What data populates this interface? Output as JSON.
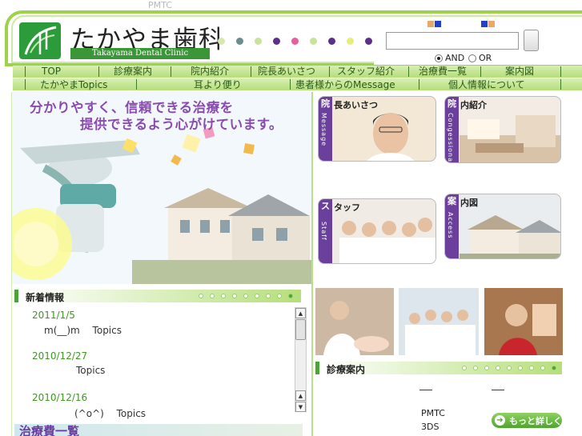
{
  "top_label": "PMTC",
  "header": {
    "title_jp": "たかやま歯科",
    "title_en": "Takayama Dental Clinic",
    "dot_colors": [
      "#d6e9b2",
      "#6a8e8e",
      "#c8e49a",
      "#5b2f8c",
      "#e85f9c",
      "#c8e49a",
      "#5b2f8c",
      "#e5ee7a",
      "#5b2f8c"
    ]
  },
  "search": {
    "input_value": "",
    "and_label": "AND",
    "or_label": "OR"
  },
  "nav": {
    "row1": [
      "TOP",
      "診療案内",
      "院内紹介",
      "院長あいさつ",
      "スタッフ紹介",
      "治療費一覧",
      "案内図"
    ],
    "row2": [
      "たかやまTopics",
      "耳より便り",
      "患者様からのMessage",
      "個人情報について"
    ]
  },
  "hero": {
    "line1": "分かりやすく、信頼できる治療を",
    "line2": "提供できるよう心がけています。"
  },
  "thumbs": {
    "message": {
      "bar_char": "院",
      "title": "長あいさつ",
      "vertical": "Message"
    },
    "clinic": {
      "bar_char": "院",
      "title": "内紹介",
      "vertical": "Congessional"
    },
    "staff": {
      "bar_char": "ス",
      "title": "タッフ",
      "vertical": "Staff"
    },
    "access": {
      "bar_char": "案",
      "title": "内図",
      "vertical": "Access"
    }
  },
  "news": {
    "heading": "新着情報",
    "items": [
      {
        "date": "2011/1/5",
        "text": "m(__)m　 Topics"
      },
      {
        "date": "2010/12/27",
        "text": "Topics"
      },
      {
        "date": "2010/12/16",
        "text": "(^o^)　 Topics"
      }
    ]
  },
  "fee_banner": "治療費一覧",
  "treatment": {
    "heading": "診療案内",
    "item1": "PMTC",
    "item2": "3DS",
    "more_label": "もっと詳しく"
  }
}
